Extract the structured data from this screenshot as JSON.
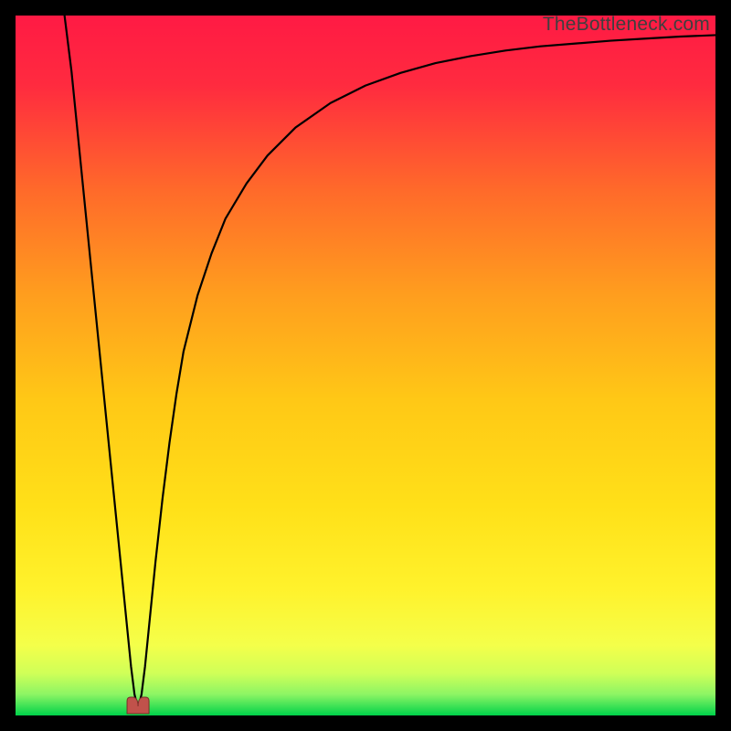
{
  "watermark": "TheBottleneck.com",
  "chart_data": {
    "type": "line",
    "title": "",
    "xlabel": "",
    "ylabel": "",
    "xlim": [
      0,
      100
    ],
    "ylim": [
      0,
      100
    ],
    "background_gradient": {
      "from": "#ff1a44",
      "mid": "#ffd400",
      "to": "#00d24a"
    },
    "notch": {
      "x": 17.5,
      "color": "#c1524b"
    },
    "series": [
      {
        "name": "bottleneck-curve",
        "x": [
          7,
          8,
          9,
          10,
          11,
          12,
          13,
          14,
          15,
          16,
          16.5,
          17,
          17.5,
          18,
          18.5,
          19,
          20,
          21,
          22,
          23,
          24,
          26,
          28,
          30,
          33,
          36,
          40,
          45,
          50,
          55,
          60,
          65,
          70,
          75,
          80,
          85,
          90,
          95,
          100
        ],
        "y": [
          100,
          92,
          82,
          72,
          62,
          52,
          42,
          32,
          22,
          12,
          7,
          3,
          1,
          3,
          7,
          12,
          22,
          31,
          39,
          46,
          52,
          60,
          66,
          71,
          76,
          80,
          84,
          87.5,
          90,
          91.8,
          93.2,
          94.2,
          95,
          95.6,
          96,
          96.4,
          96.7,
          97,
          97.2
        ]
      }
    ]
  }
}
